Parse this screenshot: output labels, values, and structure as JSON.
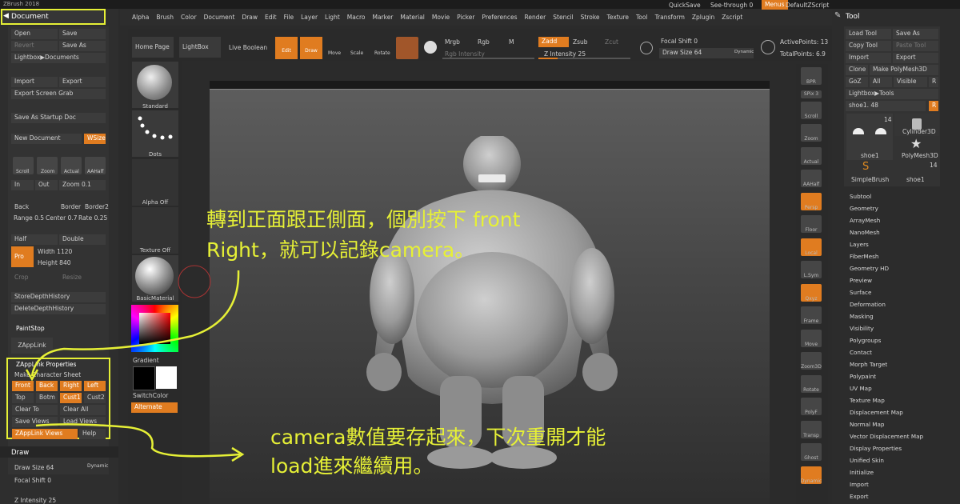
{
  "app": {
    "title": "ZBrush 2018",
    "right_top": {
      "quicksave": "QuickSave",
      "see_through": "See-through  0",
      "menus": "Menus",
      "script": "DefaultZScript"
    }
  },
  "menubar": [
    "Alpha",
    "Brush",
    "Color",
    "Document",
    "Draw",
    "Edit",
    "File",
    "Layer",
    "Light",
    "Macro",
    "Marker",
    "Material",
    "Movie",
    "Picker",
    "Preferences",
    "Render",
    "Stencil",
    "Stroke",
    "Texture",
    "Tool",
    "Transform",
    "Zplugin",
    "Zscript"
  ],
  "toolbar": {
    "home_page": "Home Page",
    "lightbox": "LightBox",
    "live_boolean": "Live Boolean",
    "edit": "Edit",
    "draw": "Draw",
    "move": "Move",
    "scale": "Scale",
    "rotate": "Rotate",
    "mrgb": "Mrgb",
    "rgb": "Rgb",
    "m": "M",
    "rgb_intensity": "Rgb Intensity",
    "zadd": "Zadd",
    "zsub": "Zsub",
    "zcut": "Zcut",
    "z_intensity": "Z Intensity 25",
    "focal_shift": "Focal Shift 0",
    "draw_size": "Draw Size 64",
    "dynamic": "Dynamic",
    "active_points": "ActivePoints: 13",
    "total_points": "TotalPoints: 6.9"
  },
  "document_panel": {
    "title": "Document",
    "open": "Open",
    "save": "Save",
    "revert": "Revert",
    "save_as": "Save As",
    "lightbox_documents": "Lightbox▶Documents",
    "import": "Import",
    "export": "Export",
    "export_screen_grab": "Export Screen Grab",
    "save_startup": "Save As Startup Doc",
    "new_document": "New Document",
    "wsize": "WSize",
    "scroll": "Scroll",
    "zoom": "Zoom",
    "actual": "Actual",
    "aahalf": "AAHalf",
    "in": "In",
    "out": "Out",
    "zoom_val": "Zoom 0.1",
    "back": "Back",
    "border": "Border",
    "border2": "Border2",
    "range": "Range 0.5",
    "center": "Center 0.7",
    "rate": "Rate 0.25",
    "half": "Half",
    "double": "Double",
    "pro": "Pro",
    "width": "Width 1120",
    "height": "Height 840",
    "crop": "Crop",
    "resize": "Resize",
    "store_depth": "StoreDepthHistory",
    "delete_depth": "DeleteDepthHistory",
    "paintstop": "PaintStop",
    "zapplink": "ZAppLink"
  },
  "zapplink_panel": {
    "title": "ZAppLink Properties",
    "make_sheet": "Make Character Sheet",
    "front": "Front",
    "back": "Back",
    "right": "Right",
    "left": "Left",
    "top": "Top",
    "bottom": "Botm",
    "cust1": "Cust1",
    "cust2": "Cust2",
    "clear_to": "Clear To",
    "clear_all": "Clear All",
    "save_views": "Save Views",
    "load_views": "Load Views",
    "zapplink_views": "ZAppLink Views",
    "help": "Help"
  },
  "draw_panel": {
    "title": "Draw",
    "draw_size": "Draw Size 64",
    "dynamic": "Dynamic",
    "focal_shift": "Focal Shift 0",
    "z_intensity": "Z Intensity 25"
  },
  "shelf": {
    "standard": "Standard",
    "dots": "Dots",
    "alpha_off": "Alpha Off",
    "texture_off": "Texture Off",
    "basic_material": "BasicMaterial",
    "gradient": "Gradient",
    "switch_color": "SwitchColor",
    "alternate": "Alternate"
  },
  "right_shelf": [
    "BPR",
    "SPix 3",
    "Scroll",
    "Zoom",
    "Actual",
    "AAHalf",
    "Persp",
    "Floor",
    "Local",
    "L.Sym",
    "Qxyz",
    "Frame",
    "Move",
    "Zoom3D",
    "Rotate",
    "PolyF",
    "Transp",
    "Ghost",
    "Dynamic"
  ],
  "tool_panel": {
    "title": "Tool",
    "load_tool": "Load Tool",
    "save_as": "Save As",
    "copy_tool": "Copy Tool",
    "paste_tool": "Paste Tool",
    "import": "Import",
    "export": "Export",
    "clone": "Clone",
    "make_polymesh": "Make PolyMesh3D",
    "goz": "GoZ",
    "all": "All",
    "visible": "Visible",
    "r": "R",
    "lightbox_tools": "Lightbox▶Tools",
    "shoe_slider": "shoe1. 48",
    "count": "14",
    "shoe1": "shoe1",
    "cylinder": "Cylinder3D",
    "polymesh": "PolyMesh3D",
    "simplebrush": "SimpleBrush",
    "shoe1b": "shoe1",
    "count2": "14",
    "items": [
      "Subtool",
      "Geometry",
      "ArrayMesh",
      "NanoMesh",
      "Layers",
      "FiberMesh",
      "Geometry HD",
      "Preview",
      "Surface",
      "Deformation",
      "Masking",
      "Visibility",
      "Polygroups",
      "Contact",
      "Morph Target",
      "Polypaint",
      "UV Map",
      "Texture Map",
      "Displacement Map",
      "Normal Map",
      "Vector Displacement Map",
      "Display Properties",
      "Unified Skin",
      "Initialize",
      "Import",
      "Export"
    ]
  },
  "annotations": {
    "line1": "轉到正面跟正側面，個別按下 front",
    "line2": "Right，就可以記錄camera。",
    "line3": "camera數值要存起來，下次重開才能",
    "line4": "load進來繼續用。"
  },
  "colors": {
    "accent": "#e07c20",
    "annotation": "#e6f036"
  }
}
